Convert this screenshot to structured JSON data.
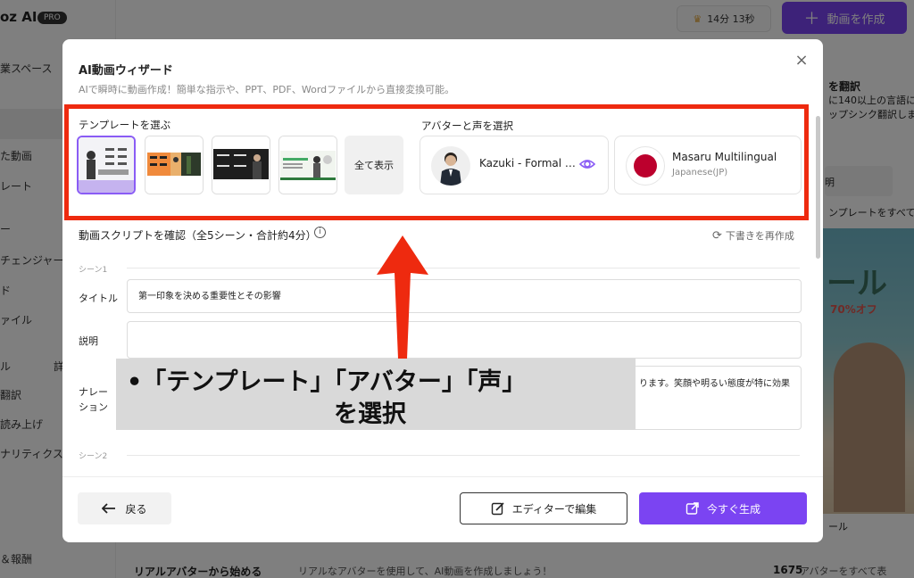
{
  "app": {
    "logo": "oz AI",
    "pro_badge": "PRO"
  },
  "sidebar": {
    "items": [
      "業スペース",
      "た動画",
      "レート",
      "ー",
      "チェンジャー",
      "ド",
      "ァイル",
      "ル",
      "翻訳",
      "読み上げ",
      "ナリティクス",
      "＆報酬"
    ],
    "extra": "詳"
  },
  "topbar": {
    "time_remaining": "14分 13秒",
    "create_button": "動画を作成"
  },
  "right_panel": {
    "title": "を翻訳",
    "line1": "に140以上の言語に、動",
    "line2": "ップシンク翻訳します。",
    "btn": "明",
    "tpl_text": "ンプレートをすべて",
    "sale": "ール",
    "off": "70%オフ",
    "caption": "ール"
  },
  "bottom": {
    "title": "リアルアバターから始める",
    "desc": "リアルなアバターを使用して、AI動画を作成しましょう！",
    "count": "1675",
    "count_suffix": "アバターをすべて表"
  },
  "modal": {
    "title": "AI動画ウィザード",
    "subtitle": "AIで瞬時に動画作成！簡単な指示や、PPT、PDF、Wordファイルから直接変換可能。",
    "close": "×",
    "template_label": "テンプレートを選ぶ",
    "show_all": "全て表示",
    "avatar_label": "アバターと声を選択",
    "avatar_name": "Kazuki - Formal …",
    "voice_name": "Masaru Multilingual",
    "voice_lang": "Japanese(JP)",
    "script_title": "動画スクリプトを確認（全5シーン・合計約4分）",
    "info_icon": "i",
    "regenerate": "下書きを再作成",
    "scene1": "シーン1",
    "title_label": "タイトル",
    "title_value": "第一印象を決める重要性とその影響",
    "desc_label": "説明",
    "narration_label_1": "ナレー",
    "narration_label_2": "ション",
    "narration_value": "ります。笑顔や明るい態度が特に効果",
    "scene2": "シーン2",
    "back": "戻る",
    "edit": "エディターで編集",
    "generate": "今すぐ生成"
  },
  "annotation": {
    "line1": "•「テンプレート」「アバター」「声」",
    "line2": "を選択",
    "highlight_color": "#ee2a0f",
    "callout_bg": "#d9d9d9"
  },
  "colors": {
    "accent": "#7b44f2",
    "selected_border": "#8a5cf5"
  }
}
